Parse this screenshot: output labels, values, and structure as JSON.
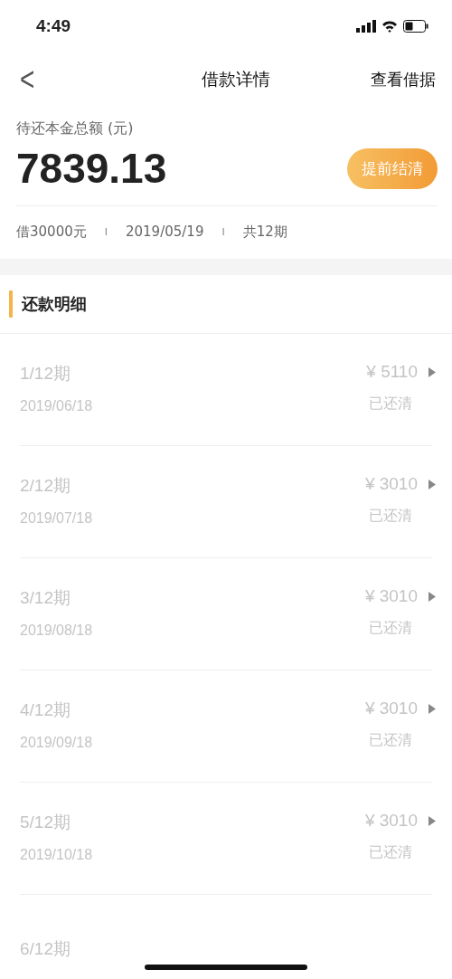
{
  "status_bar": {
    "time": "4:49"
  },
  "nav": {
    "back": "<",
    "title": "借款详情",
    "action": "查看借据"
  },
  "summary": {
    "label": "待还本金总额 (元)",
    "amount": "7839.13",
    "button": "提前结清",
    "info": [
      "借30000元",
      "2019/05/19",
      "共12期"
    ],
    "separators": [
      "I",
      "I"
    ]
  },
  "section": {
    "title": "还款明细"
  },
  "installments": [
    {
      "period": "1/12期",
      "amount": "¥ 5110",
      "date": "2019/06/18",
      "status": "已还清",
      "paid": true
    },
    {
      "period": "2/12期",
      "amount": "¥ 3010",
      "date": "2019/07/18",
      "status": "已还清",
      "paid": true
    },
    {
      "period": "3/12期",
      "amount": "¥ 3010",
      "date": "2019/08/18",
      "status": "已还清",
      "paid": true
    },
    {
      "period": "4/12期",
      "amount": "¥ 3010",
      "date": "2019/09/18",
      "status": "已还清",
      "paid": true
    },
    {
      "period": "5/12期",
      "amount": "¥ 3010",
      "date": "2019/10/18",
      "status": "已还清",
      "paid": true
    },
    {
      "period": "6/12期",
      "paid": true
    }
  ]
}
